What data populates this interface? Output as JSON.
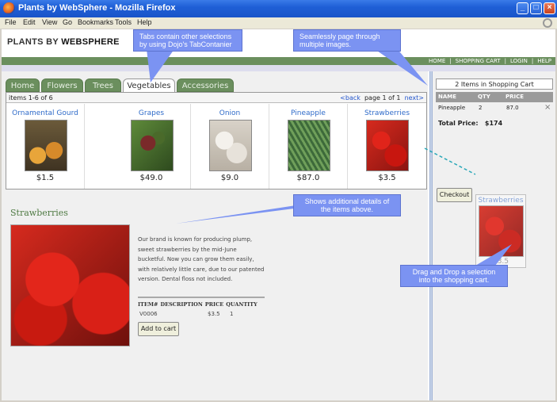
{
  "window": {
    "title": "Plants by WebSphere - Mozilla Firefox"
  },
  "menu": [
    "File",
    "Edit",
    "View",
    "Go",
    "Bookmarks",
    "Tools",
    "Help"
  ],
  "site": {
    "logo_prefix": "PLANTS BY ",
    "logo_brand": "WEBSPHERE",
    "nav": [
      "HOME",
      "SHOPPING CART",
      "LOGIN",
      "HELP"
    ],
    "nav_sep": "|"
  },
  "tabs": [
    {
      "label": "Home",
      "active": false
    },
    {
      "label": "Flowers",
      "active": false
    },
    {
      "label": "Trees",
      "active": false
    },
    {
      "label": "Vegetables",
      "active": true
    },
    {
      "label": "Accessories",
      "active": false
    }
  ],
  "catalog": {
    "items_label": "items 1-6 of 6",
    "back": "<back",
    "page": "page 1 of 1",
    "next": "next>",
    "items": [
      {
        "name": "Ornamental Gourd",
        "price": "$1.5",
        "image": "gourd"
      },
      {
        "name": "Grapes",
        "price": "$49.0",
        "image": "grapes"
      },
      {
        "name": "Onion",
        "price": "$9.0",
        "image": "onion"
      },
      {
        "name": "Pineapple",
        "price": "$87.0",
        "image": "pineapple"
      },
      {
        "name": "Strawberries",
        "price": "$3.5",
        "image": "strawberries"
      }
    ]
  },
  "detail": {
    "title": "Strawberries",
    "description": "Our brand is known for producing plump, sweet strawberries by the mid-June bucketful. Now you can grow them easily, with relatively little care, due to our patented version. Dental floss not included.",
    "columns": [
      "ITEM#",
      "DESCRIPTION",
      "PRICE",
      "QUANTITY"
    ],
    "item_no": "V0006",
    "price": "$3.5",
    "quantity": "1",
    "add_button": "Add to cart"
  },
  "cart": {
    "title": "2 Items in Shopping Cart",
    "columns": [
      "NAME",
      "QTY",
      "PRICE"
    ],
    "row": {
      "name": "Pineapple",
      "qty": "2",
      "price": "87.0",
      "remove": "×"
    },
    "total_label": "Total Price:",
    "total_value": "$174",
    "checkout": "Checkout",
    "drag_name": "Strawberries",
    "drag_price": "$3.5"
  },
  "callouts": {
    "tabs": "Tabs contain other selections by using Dojo's TabContanier",
    "paging": "Seamlessly page through multiple images.",
    "details": "Shows additional details of the items above.",
    "drag": "Drag and Drop a selection into the shopping cart."
  },
  "colors": {
    "accent_green": "#6b8f5e",
    "callout_blue": "#7b93f2",
    "link_blue": "#2f6bc9"
  }
}
